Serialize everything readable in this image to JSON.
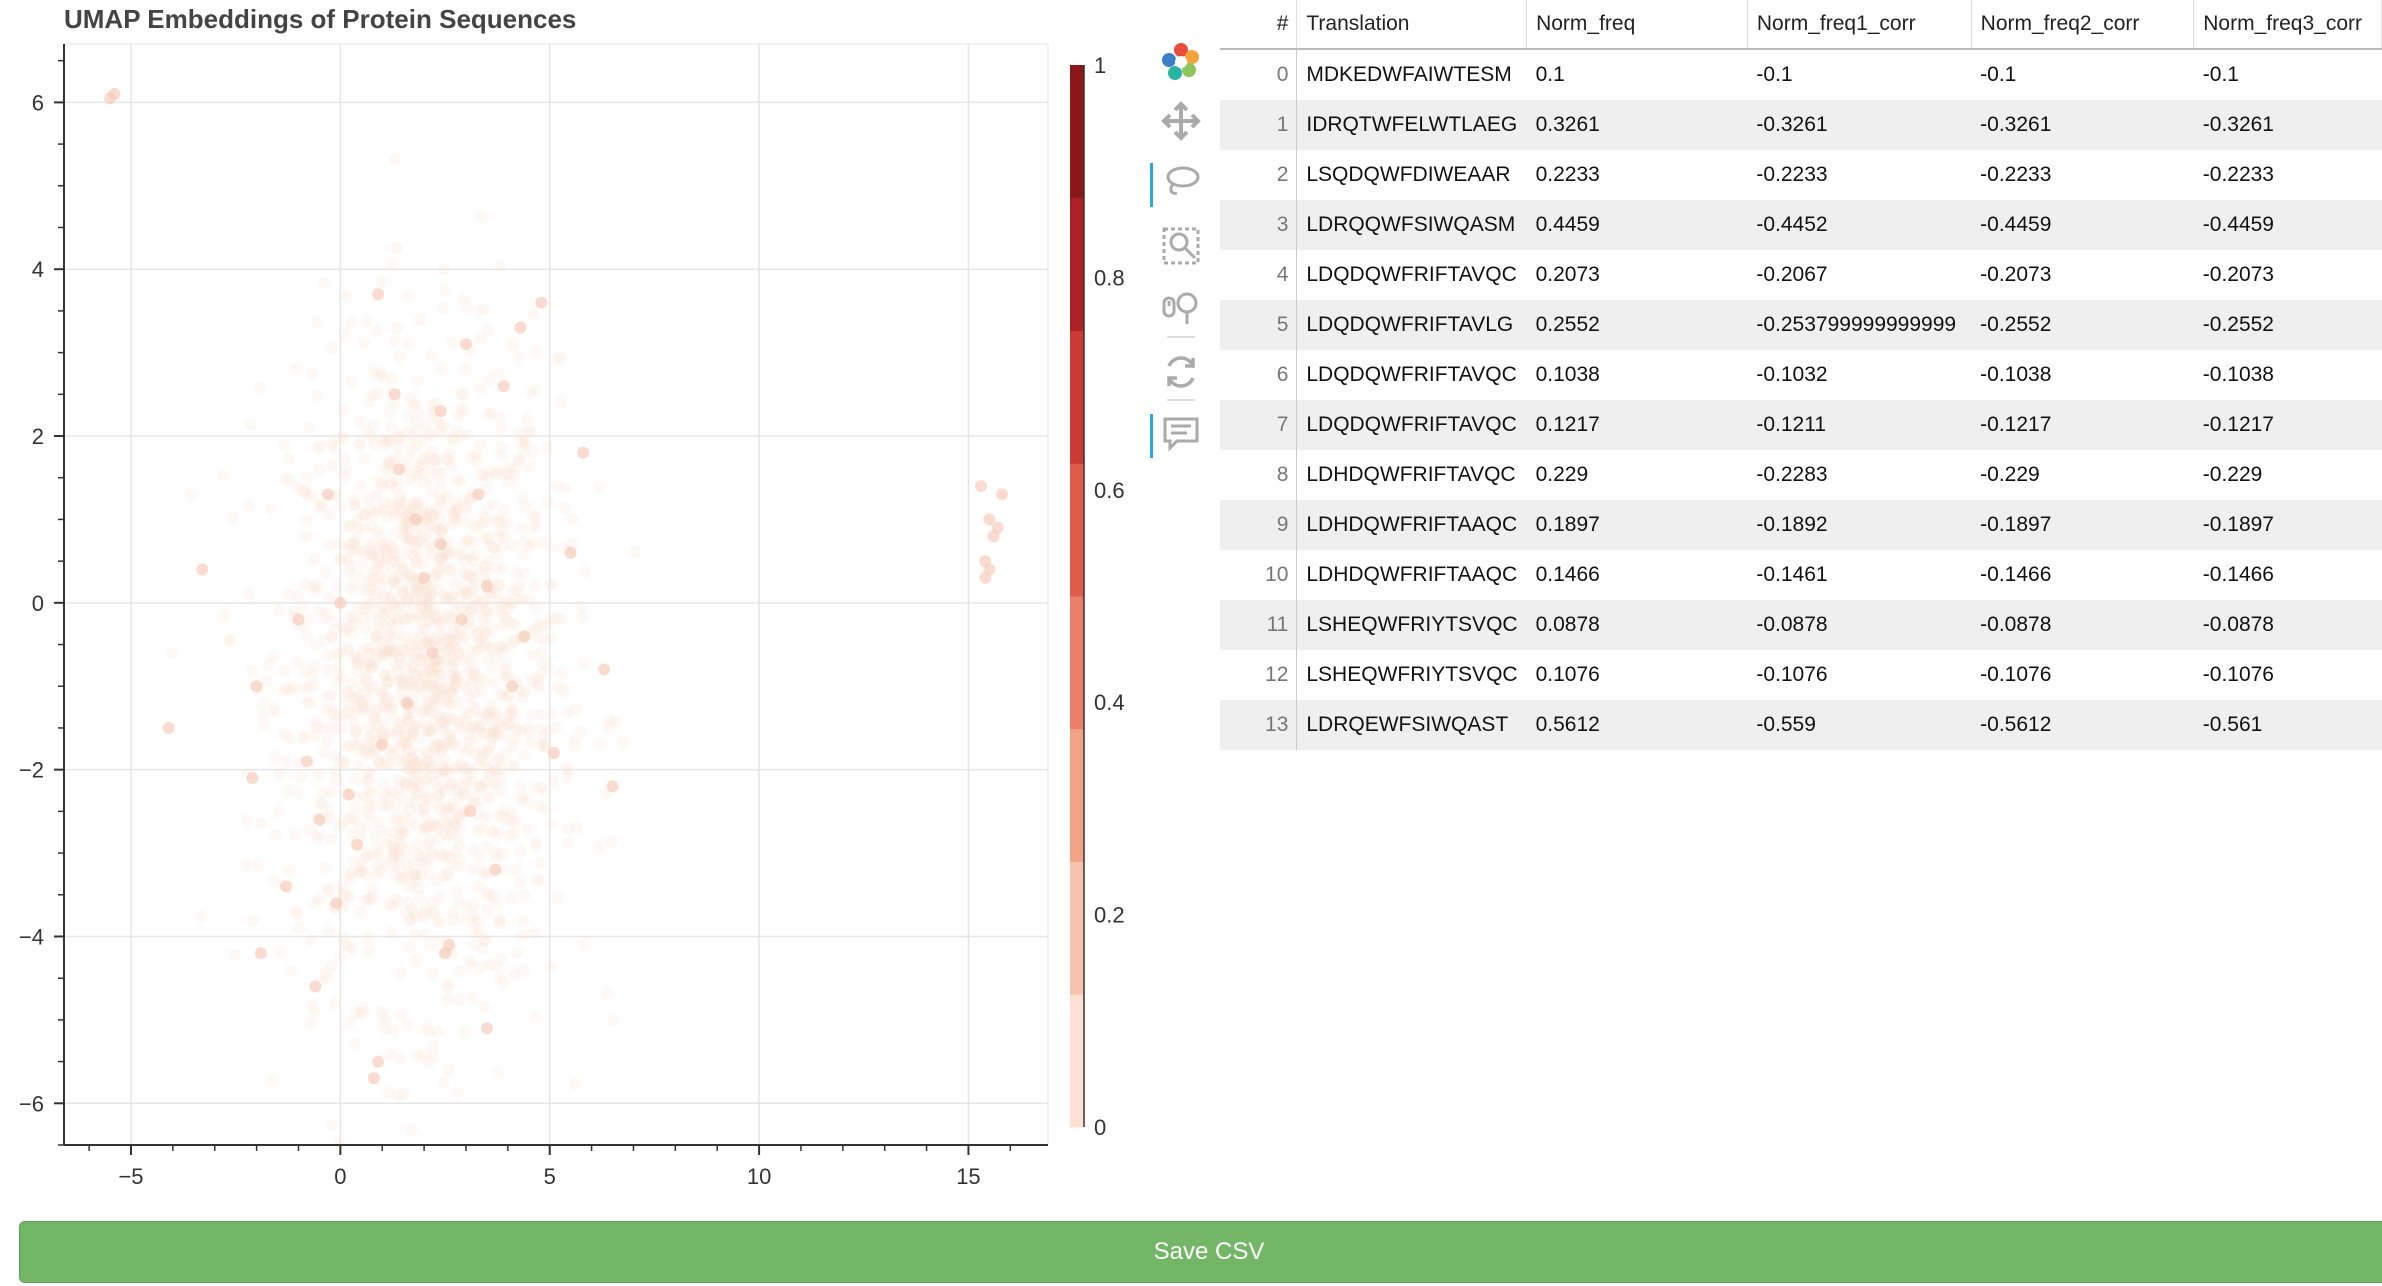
{
  "chart_data": {
    "type": "scatter",
    "title": "UMAP Embeddings of Protein Sequences",
    "xlabel": "",
    "ylabel": "",
    "xlim": [
      -6.6,
      16.9
    ],
    "ylim": [
      -6.5,
      6.7
    ],
    "x_ticks": [
      -5,
      0,
      5,
      10,
      15
    ],
    "y_ticks": [
      -6,
      -4,
      -2,
      0,
      2,
      4,
      6
    ],
    "x_tick_labels": [
      "−5",
      "0",
      "5",
      "10",
      "15"
    ],
    "y_tick_labels": [
      "−6",
      "−4",
      "−2",
      "0",
      "2",
      "4",
      "6"
    ],
    "grid": true,
    "point_color": "#fbdccf",
    "point_opacity": 0.35,
    "series": [
      {
        "values_x": [
          -5.5,
          -5.4,
          -3.3,
          -4.1,
          0.0,
          -0.3,
          -2.0,
          -1.0,
          0.9,
          1.3,
          2.4,
          3.0,
          3.9,
          4.3,
          4.8,
          5.8,
          5.5,
          6.3,
          6.5,
          3.5,
          2.6,
          2.5,
          0.8,
          0.9,
          -0.6,
          -0.1,
          -1.3,
          -1.9,
          -2.1,
          1.8,
          2.4,
          3.5,
          4.4,
          5.1,
          0.2,
          0.4,
          1.0,
          1.6,
          2.2,
          3.1,
          3.7,
          4.1,
          -0.8,
          -0.5,
          1.4,
          2.0,
          2.9,
          3.3,
          15.3,
          15.5,
          15.8,
          15.6,
          15.4,
          15.7,
          15.4,
          15.5
        ],
        "values_y": [
          6.05,
          6.1,
          0.4,
          -1.5,
          0.0,
          1.3,
          -1.0,
          -0.2,
          3.7,
          2.5,
          2.3,
          3.1,
          2.6,
          3.3,
          3.6,
          1.8,
          0.6,
          -0.8,
          -2.2,
          -5.1,
          -4.1,
          -4.2,
          -5.7,
          -5.5,
          -4.6,
          -3.6,
          -3.4,
          -4.2,
          -2.1,
          1.0,
          0.7,
          0.2,
          -0.4,
          -1.8,
          -2.3,
          -2.9,
          -1.7,
          -1.2,
          -0.6,
          -2.5,
          -3.2,
          -1.0,
          -1.9,
          -2.6,
          1.6,
          0.3,
          -0.2,
          1.3,
          1.4,
          1.0,
          1.3,
          0.8,
          0.5,
          0.9,
          0.3,
          0.4
        ],
        "cluster_center": [
          2.0,
          -0.9
        ],
        "cluster_spread": [
          1.6,
          1.9
        ],
        "cluster_size": 1800
      }
    ],
    "colorbar": {
      "ticks": [
        "0",
        "0.2",
        "0.4",
        "0.6",
        "0.8",
        "1"
      ],
      "colors": [
        "#fde0d2",
        "#f7c3ad",
        "#f1a386",
        "#ea8166",
        "#df5c48",
        "#cc3a33",
        "#ad2026",
        "#8b1719"
      ]
    }
  },
  "toolbar": {
    "tools": [
      {
        "icon": "bokeh-logo-icon",
        "active": false
      },
      {
        "icon": "pan-icon",
        "active": false
      },
      {
        "icon": "lasso-select-icon",
        "active": true
      },
      {
        "icon": "box-zoom-icon",
        "active": false
      },
      {
        "icon": "wheel-zoom-icon",
        "active": false
      },
      {
        "icon": "reset-icon",
        "active": false
      },
      {
        "icon": "hover-icon",
        "active": true
      }
    ]
  },
  "table": {
    "columns": [
      "#",
      "Translation",
      "Norm_freq",
      "Norm_freq1_corr",
      "Norm_freq2_corr",
      "Norm_freq3_corr"
    ],
    "rows": [
      [
        "0",
        "MDKEDWFAIWTESM",
        "0.1",
        "-0.1",
        "-0.1",
        "-0.1"
      ],
      [
        "1",
        "IDRQTWFELWTLAEG",
        "0.3261",
        "-0.3261",
        "-0.3261",
        "-0.3261"
      ],
      [
        "2",
        "LSQDQWFDIWEAAR",
        "0.2233",
        "-0.2233",
        "-0.2233",
        "-0.2233"
      ],
      [
        "3",
        "LDRQQWFSIWQASM",
        "0.4459",
        "-0.4452",
        "-0.4459",
        "-0.4459"
      ],
      [
        "4",
        "LDQDQWFRIFTAVQC",
        "0.2073",
        "-0.2067",
        "-0.2073",
        "-0.2073"
      ],
      [
        "5",
        "LDQDQWFRIFTAVLG",
        "0.2552",
        "-0.253799999999999",
        "-0.2552",
        "-0.2552"
      ],
      [
        "6",
        "LDQDQWFRIFTAVQC",
        "0.1038",
        "-0.1032",
        "-0.1038",
        "-0.1038"
      ],
      [
        "7",
        "LDQDQWFRIFTAVQC",
        "0.1217",
        "-0.1211",
        "-0.1217",
        "-0.1217"
      ],
      [
        "8",
        "LDHDQWFRIFTAVQC",
        "0.229",
        "-0.2283",
        "-0.229",
        "-0.229"
      ],
      [
        "9",
        "LDHDQWFRIFTAAQC",
        "0.1897",
        "-0.1892",
        "-0.1897",
        "-0.1897"
      ],
      [
        "10",
        "LDHDQWFRIFTAAQC",
        "0.1466",
        "-0.1461",
        "-0.1466",
        "-0.1466"
      ],
      [
        "11",
        "LSHEQWFRIYTSVQC",
        "0.0878",
        "-0.0878",
        "-0.0878",
        "-0.0878"
      ],
      [
        "12",
        "LSHEQWFRIYTSVQC",
        "0.1076",
        "-0.1076",
        "-0.1076",
        "-0.1076"
      ],
      [
        "13",
        "LDRQEWFSIWQAST",
        "0.5612",
        "-0.559",
        "-0.5612",
        "-0.561"
      ]
    ]
  },
  "save_button": {
    "label": "Save CSV"
  }
}
